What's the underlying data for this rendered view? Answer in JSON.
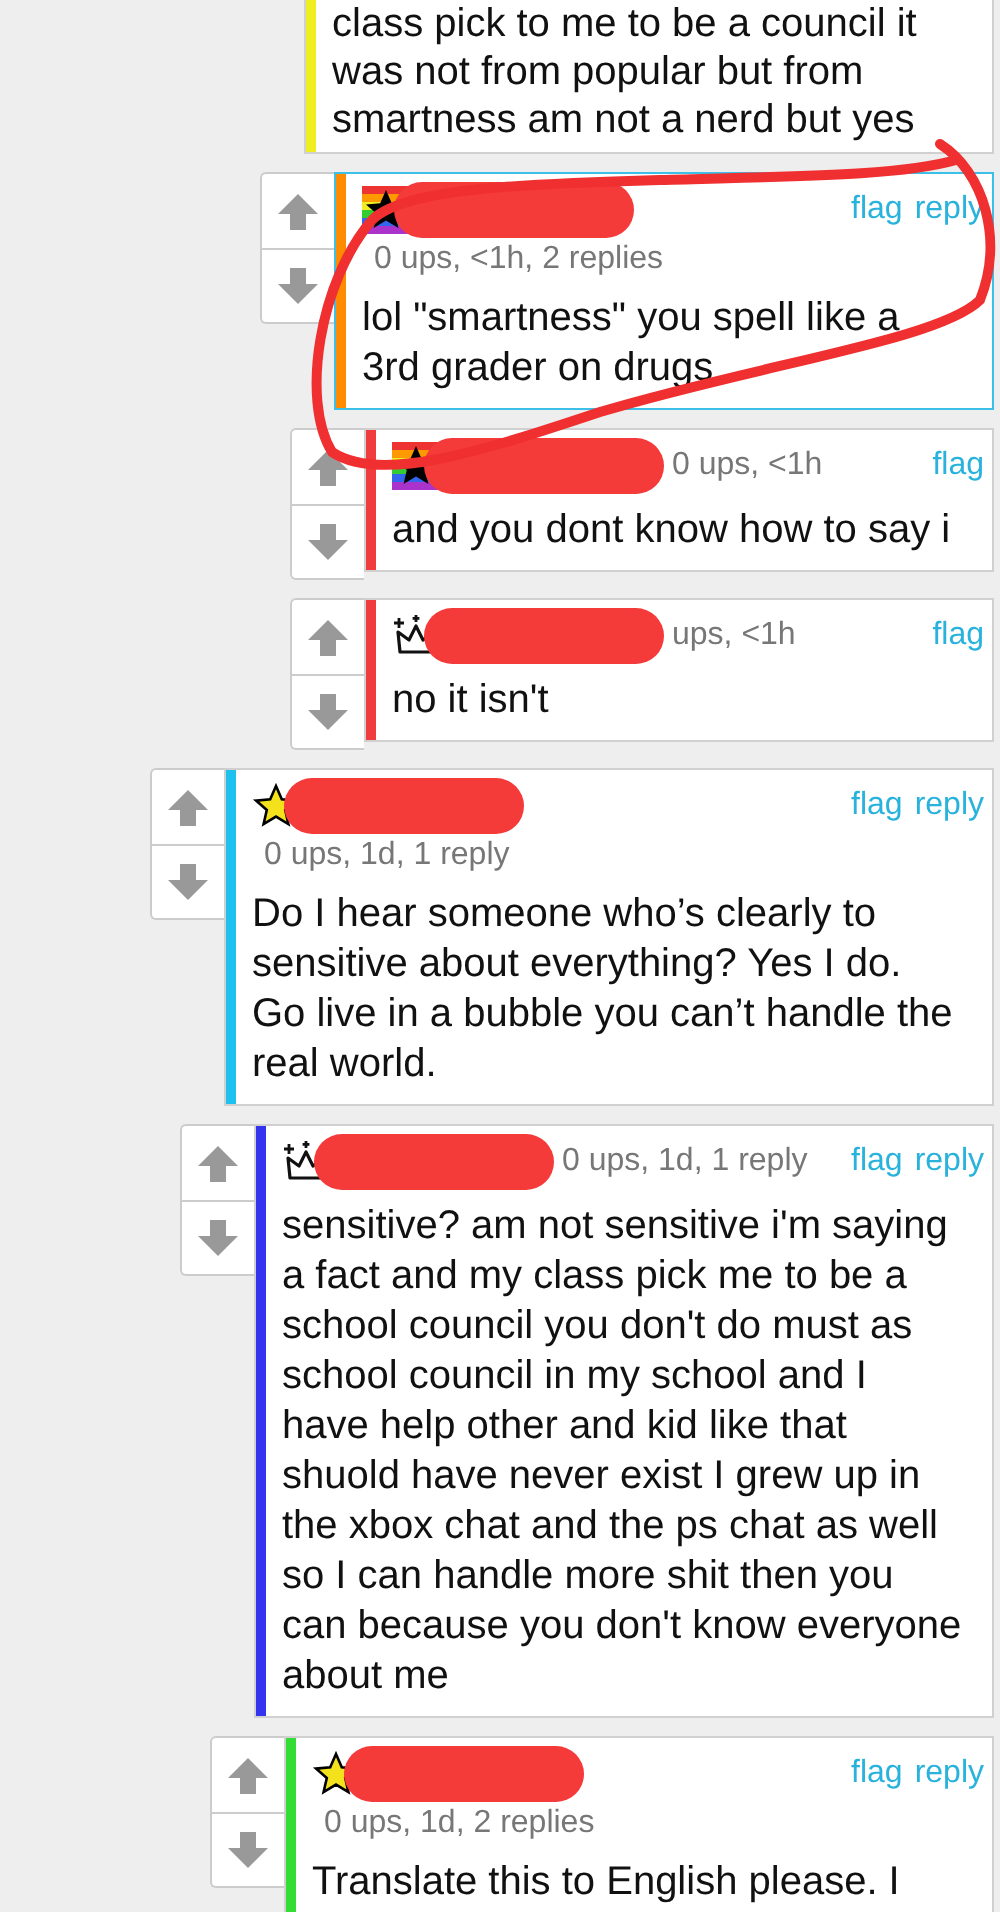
{
  "threads": [
    {
      "comments": [
        {
          "kind": "cut",
          "color": "#eeee22",
          "highlighted": false,
          "text": "class pick to me to be a council it was not from popular but from smartness am not a nerd but yes",
          "children": [
            {
              "kind": "stacked",
              "color": "#ff8c00",
              "highlighted": true,
              "badge": {
                "kind": "rainbow-star"
              },
              "meta": "0 ups, <1h, 2 replies",
              "links": [
                "flag",
                "reply"
              ],
              "text": "lol \"smartness\" you spell like a 3rd grader on drugs",
              "children": [
                {
                  "kind": "inline",
                  "color": "#f03c3c",
                  "highlighted": false,
                  "badge": {
                    "kind": "rainbow-star"
                  },
                  "meta": "0 ups, <1h",
                  "links": [
                    "flag"
                  ],
                  "text": "and you dont know how to say i"
                },
                {
                  "kind": "inline",
                  "color": "#f03c3c",
                  "highlighted": false,
                  "badge": {
                    "kind": "crown"
                  },
                  "meta": "ups, <1h",
                  "links": [
                    "flag"
                  ],
                  "text": "no it isn't"
                }
              ]
            }
          ]
        }
      ]
    },
    {
      "comments": [
        {
          "kind": "stacked",
          "color": "#1ec0ee",
          "highlighted": false,
          "badge": {
            "kind": "star"
          },
          "meta": "0 ups, 1d, 1 reply",
          "links": [
            "flag",
            "reply"
          ],
          "text": "Do I hear someone who’s clearly to sensitive about everything? Yes I do. Go live in a bubble you can’t handle the real world.",
          "children": [
            {
              "kind": "inline",
              "color": "#3434ee",
              "highlighted": false,
              "badge": {
                "kind": "crown"
              },
              "meta": "0 ups, 1d, 1 reply",
              "links": [
                "flag",
                "reply"
              ],
              "text": "sensitive? am not sensitive i'm saying a fact and my class pick me to be a school council you don't do must as school council in my school and I have help other and kid like that shuold have never exist I grew up in the xbox chat and the ps chat as well so I can handle more shit then you can because you don't know everyone about me",
              "children": [
                {
                  "kind": "stacked",
                  "color": "#33dd33",
                  "highlighted": false,
                  "badge": {
                    "kind": "star"
                  },
                  "meta": "0 ups, 1d, 2 replies",
                  "links": [
                    "flag",
                    "reply"
                  ],
                  "text": "Translate this to English please. I"
                }
              ]
            }
          ]
        }
      ]
    }
  ]
}
